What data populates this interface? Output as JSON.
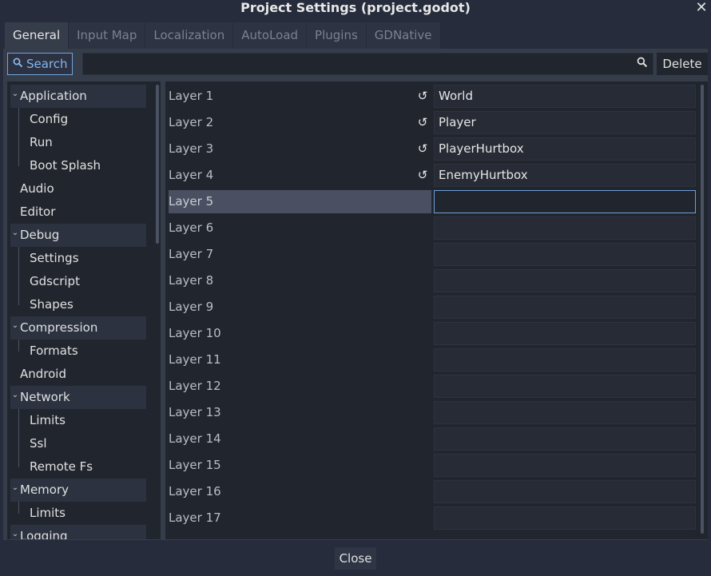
{
  "window": {
    "title": "Project Settings (project.godot)",
    "close_glyph": "✕"
  },
  "tabs": [
    {
      "label": "General",
      "active": true
    },
    {
      "label": "Input Map",
      "active": false
    },
    {
      "label": "Localization",
      "active": false
    },
    {
      "label": "AutoLoad",
      "active": false
    },
    {
      "label": "Plugins",
      "active": false
    },
    {
      "label": "GDNative",
      "active": false
    }
  ],
  "toolbar": {
    "search_label": "Search",
    "search_value": "",
    "delete_label": "Delete"
  },
  "tree": [
    {
      "label": "Application",
      "kind": "section"
    },
    {
      "label": "Config",
      "kind": "child"
    },
    {
      "label": "Run",
      "kind": "child"
    },
    {
      "label": "Boot Splash",
      "kind": "child"
    },
    {
      "label": "Audio",
      "kind": "plain"
    },
    {
      "label": "Editor",
      "kind": "plain"
    },
    {
      "label": "Debug",
      "kind": "section"
    },
    {
      "label": "Settings",
      "kind": "child"
    },
    {
      "label": "Gdscript",
      "kind": "child"
    },
    {
      "label": "Shapes",
      "kind": "child"
    },
    {
      "label": "Compression",
      "kind": "section"
    },
    {
      "label": "Formats",
      "kind": "child"
    },
    {
      "label": "Android",
      "kind": "plain"
    },
    {
      "label": "Network",
      "kind": "section"
    },
    {
      "label": "Limits",
      "kind": "child"
    },
    {
      "label": "Ssl",
      "kind": "child"
    },
    {
      "label": "Remote Fs",
      "kind": "child"
    },
    {
      "label": "Memory",
      "kind": "section"
    },
    {
      "label": "Limits",
      "kind": "child"
    },
    {
      "label": "Logging",
      "kind": "section"
    }
  ],
  "layers": [
    {
      "label": "Layer 1",
      "value": "World",
      "revert": true
    },
    {
      "label": "Layer 2",
      "value": "Player",
      "revert": true
    },
    {
      "label": "Layer 3",
      "value": "PlayerHurtbox",
      "revert": true
    },
    {
      "label": "Layer 4",
      "value": "EnemyHurtbox",
      "revert": true
    },
    {
      "label": "Layer 5",
      "value": "",
      "revert": false,
      "selected": true
    },
    {
      "label": "Layer 6",
      "value": "",
      "revert": false
    },
    {
      "label": "Layer 7",
      "value": "",
      "revert": false
    },
    {
      "label": "Layer 8",
      "value": "",
      "revert": false
    },
    {
      "label": "Layer 9",
      "value": "",
      "revert": false
    },
    {
      "label": "Layer 10",
      "value": "",
      "revert": false
    },
    {
      "label": "Layer 11",
      "value": "",
      "revert": false
    },
    {
      "label": "Layer 12",
      "value": "",
      "revert": false
    },
    {
      "label": "Layer 13",
      "value": "",
      "revert": false
    },
    {
      "label": "Layer 14",
      "value": "",
      "revert": false
    },
    {
      "label": "Layer 15",
      "value": "",
      "revert": false
    },
    {
      "label": "Layer 16",
      "value": "",
      "revert": false
    },
    {
      "label": "Layer 17",
      "value": "",
      "revert": false
    }
  ],
  "footer": {
    "close_label": "Close"
  },
  "colors": {
    "accent": "#6fa4dc",
    "background": "#262c3b",
    "panel": "#363d4a",
    "field": "#21262e"
  },
  "icons": {
    "search": "search-icon",
    "revert": "revert-icon",
    "chevron": "chevron-down-icon"
  }
}
